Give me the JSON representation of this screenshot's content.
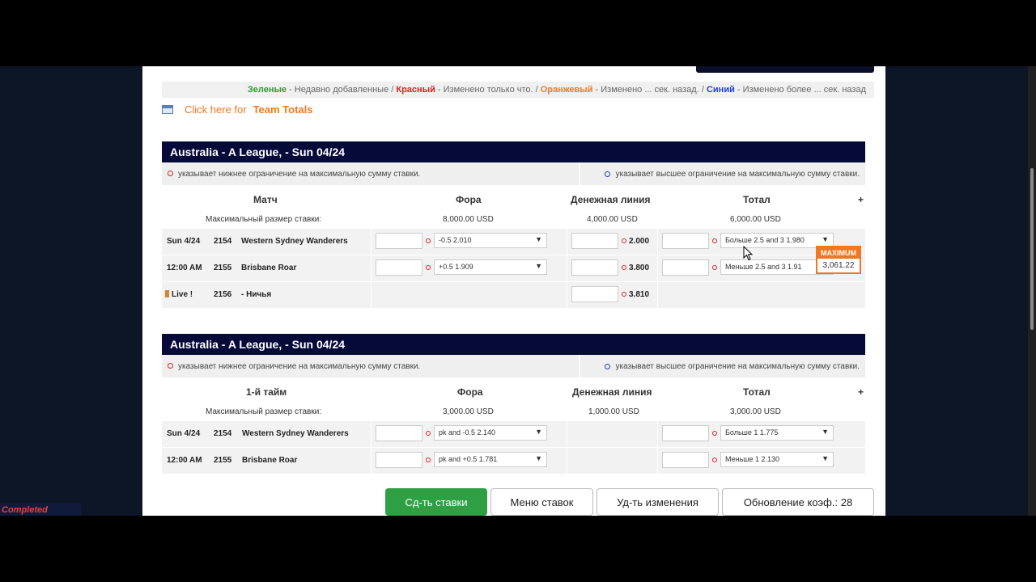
{
  "legend": {
    "green_word": "Зеленые",
    "green_text": " - Недавно добавленные / ",
    "red_word": "Красный",
    "red_text": " - Изменено только что. / ",
    "orange_word": "Оранжевый",
    "orange_text": " - Изменено ... сек. назад. / ",
    "blue_word": "Синий",
    "blue_text": " - Изменено более ... сек. назад"
  },
  "team_totals": {
    "link": "Click here for",
    "label": "Team Totals"
  },
  "limits": {
    "lower": "указывает нижнее ограничение на максимальную сумму ставки.",
    "upper": "указывает высшее ограничение на максимальную сумму ставки."
  },
  "section1": {
    "title": "Australia - A League, - Sun 04/24",
    "headers": {
      "match": "Матч",
      "handicap": "Фора",
      "moneyline": "Денежная линия",
      "total": "Тотал",
      "plus": "+"
    },
    "max_label": "Максимальный размер ставки:",
    "max": {
      "handicap": "8,000.00 USD",
      "moneyline": "4,000.00 USD",
      "total": "6,000.00 USD"
    },
    "rows": [
      {
        "time": "Sun 4/24",
        "num": "2154",
        "team": "Western Sydney Wanderers",
        "handicap": "-0.5   2.010",
        "ml": "2.000",
        "total": "Больше 2.5 and 3   1.980"
      },
      {
        "time": "12:00 AM",
        "num": "2155",
        "team": "Brisbane Roar",
        "handicap": "+0.5   1.909",
        "ml": "3.800",
        "total": "Меньше 2.5 and 3   1.91"
      },
      {
        "time": "Live !",
        "num": "2156",
        "team": "- Ничья",
        "ml": "3.810"
      }
    ],
    "popup": {
      "title": "MAXIMUM",
      "value": "3,061.22"
    }
  },
  "section2": {
    "title": "Australia - A League, - Sun 04/24",
    "headers": {
      "match": "1-й тайм",
      "handicap": "Фора",
      "moneyline": "Денежная линия",
      "total": "Тотал",
      "plus": "+"
    },
    "max_label": "Максимальный размер ставки:",
    "max": {
      "handicap": "3,000.00 USD",
      "moneyline": "1,000.00 USD",
      "total": "3,000.00 USD"
    },
    "rows": [
      {
        "time": "Sun 4/24",
        "num": "2154",
        "team": "Western Sydney Wanderers",
        "handicap": "pk and -0.5   2.140",
        "total": "Больше 1   1.775"
      },
      {
        "time": "12:00 AM",
        "num": "2155",
        "team": "Brisbane Roar",
        "handicap": "pk and +0.5   1.781",
        "total": "Меньше 1   2.130"
      }
    ]
  },
  "buttons": {
    "place": "Сд-ть ставки",
    "menu": "Меню ставок",
    "remove": "Уд-ть изменения",
    "refresh": "Обновление коэф.: 28"
  },
  "status": {
    "completed": "Completed"
  },
  "colors": {
    "header_bg": "#060a38",
    "accent_orange": "#f07820",
    "green_button": "#2ea043"
  }
}
